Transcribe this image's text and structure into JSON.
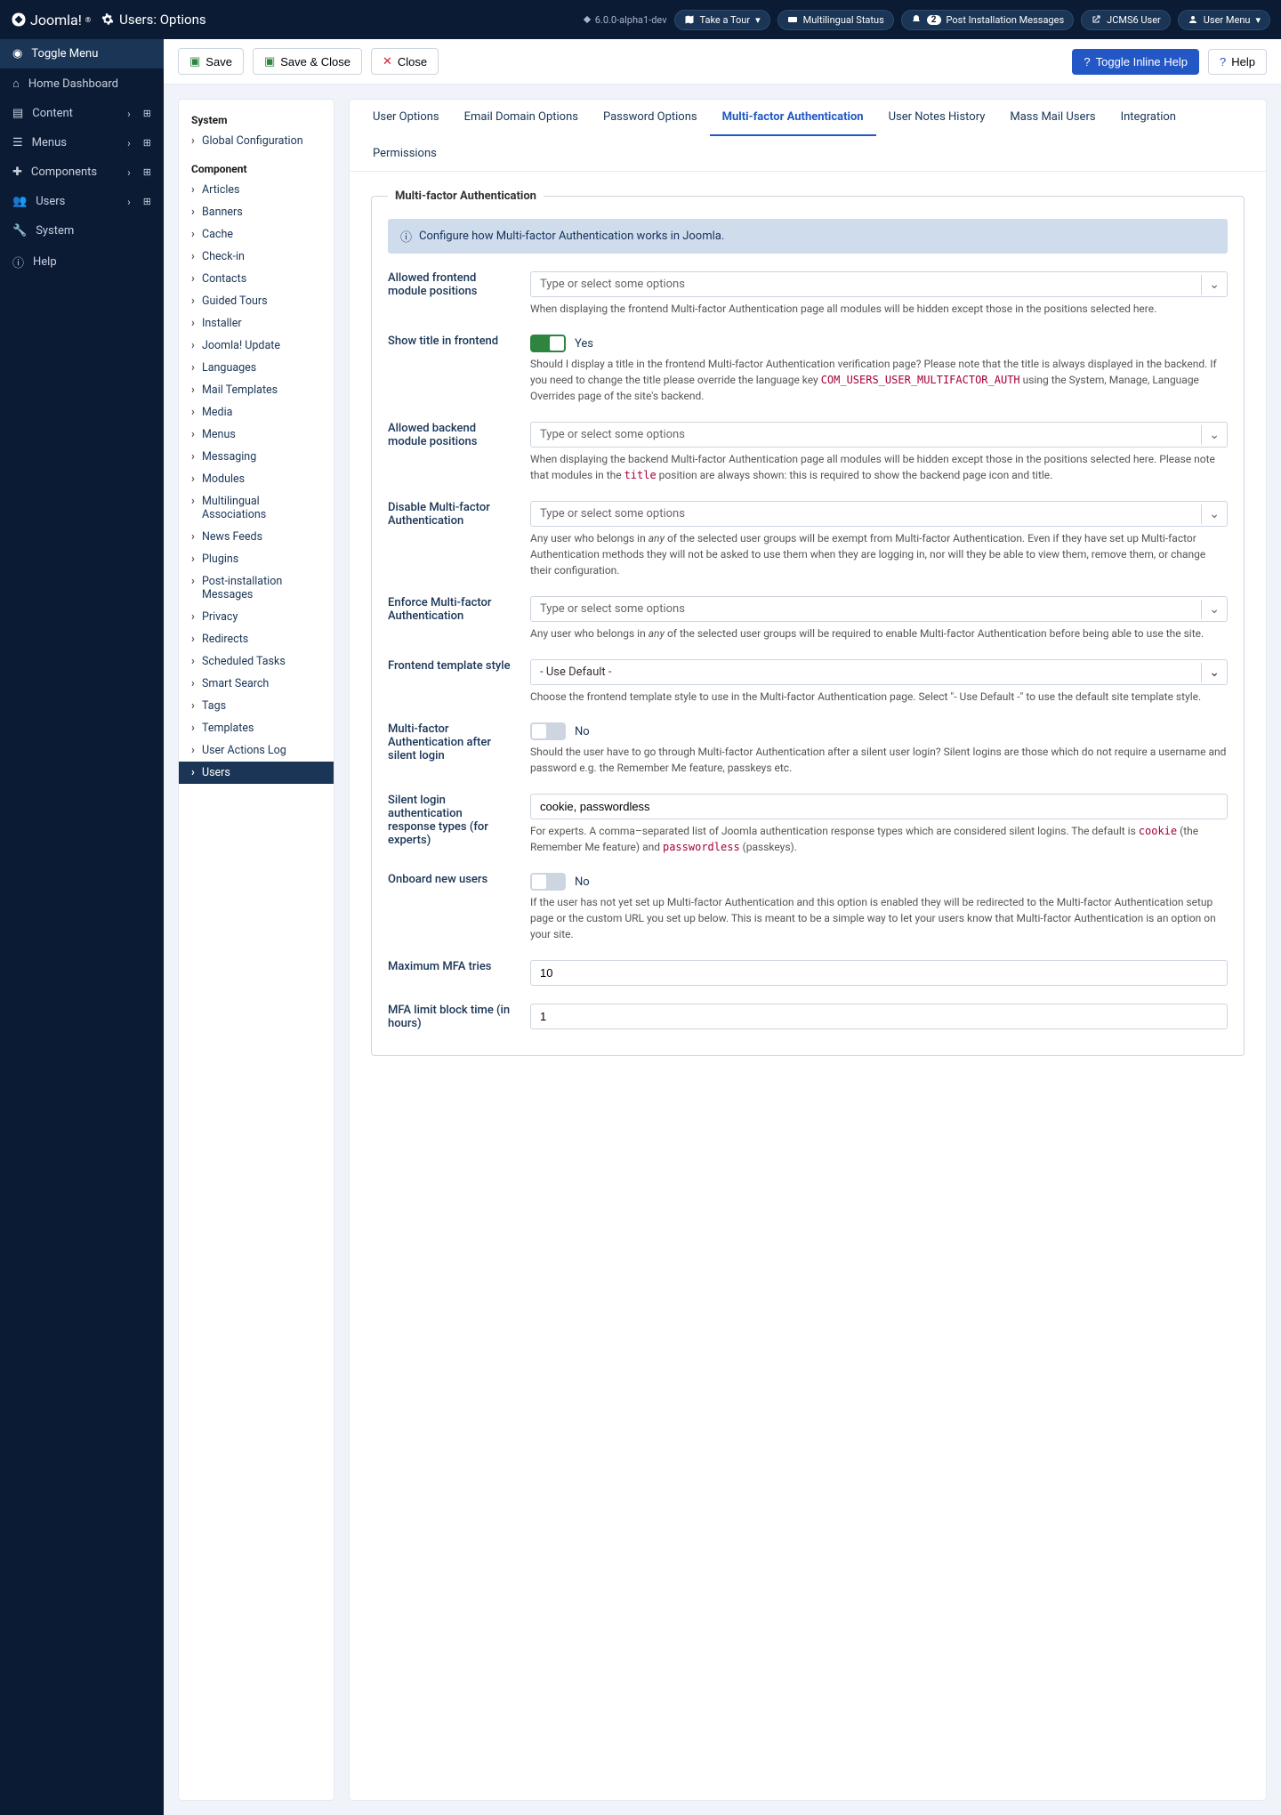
{
  "brand": "Joomla!",
  "page_title": "Users: Options",
  "version": "6.0.0-alpha1-dev",
  "header_chips": {
    "tour": "Take a Tour",
    "multilingual": "Multilingual Status",
    "post_install": "Post Installation Messages",
    "post_install_count": "2",
    "site_link": "JCMS6 User",
    "user_menu": "User Menu"
  },
  "sidebar": {
    "toggle": "Toggle Menu",
    "home": "Home Dashboard",
    "content": "Content",
    "menus": "Menus",
    "components": "Components",
    "users": "Users",
    "system": "System",
    "help": "Help"
  },
  "toolbar": {
    "save": "Save",
    "save_close": "Save & Close",
    "close": "Close",
    "toggle_help": "Toggle Inline Help",
    "help": "Help"
  },
  "leftmenu": {
    "system_h": "System",
    "global_config": "Global Configuration",
    "component_h": "Component",
    "items": [
      "Articles",
      "Banners",
      "Cache",
      "Check-in",
      "Contacts",
      "Guided Tours",
      "Installer",
      "Joomla! Update",
      "Languages",
      "Mail Templates",
      "Media",
      "Menus",
      "Messaging",
      "Modules",
      "Multilingual Associations",
      "News Feeds",
      "Plugins",
      "Post-installation Messages",
      "Privacy",
      "Redirects",
      "Scheduled Tasks",
      "Smart Search",
      "Tags",
      "Templates",
      "User Actions Log",
      "Users"
    ],
    "active_index": 25
  },
  "tabs": [
    "User Options",
    "Email Domain Options",
    "Password Options",
    "Multi-factor Authentication",
    "User Notes History",
    "Mass Mail Users",
    "Integration",
    "Permissions"
  ],
  "active_tab": 3,
  "fieldset_legend": "Multi-factor Authentication",
  "alert_text": "Configure how Multi-factor Authentication works in Joomla.",
  "fields": {
    "frontend_positions": {
      "label": "Allowed frontend module positions",
      "placeholder": "Type or select some options",
      "desc": "When displaying the frontend Multi-factor Authentication page all modules will be hidden except those in the positions selected here."
    },
    "show_title": {
      "label": "Show title in frontend",
      "value": "Yes",
      "desc_pre": "Should I display a title in the frontend Multi-factor Authentication verification page? Please note that the title is always displayed in the backend. If you need to change the title please override the language key ",
      "desc_code": "COM_USERS_USER_MULTIFACTOR_AUTH",
      "desc_post": " using the System, Manage, Language Overrides page of the site's backend."
    },
    "backend_positions": {
      "label": "Allowed backend module positions",
      "placeholder": "Type or select some options",
      "desc_pre": "When displaying the backend Multi-factor Authentication page all modules will be hidden except those in the positions selected here. Please note that modules in the ",
      "desc_code": "title",
      "desc_post": " position are always shown: this is required to show the backend page icon and title."
    },
    "disable_mfa": {
      "label": "Disable Multi-factor Authentication",
      "placeholder": "Type or select some options",
      "desc_pre": "Any user who belongs in ",
      "desc_em": "any",
      "desc_post": " of the selected user groups will be exempt from Multi-factor Authentication. Even if they have set up Multi-factor Authentication methods they will not be asked to use them when they are logging in, nor will they be able to view them, remove them, or change their configuration."
    },
    "enforce_mfa": {
      "label": "Enforce Multi-factor Authentication",
      "placeholder": "Type or select some options",
      "desc_pre": "Any user who belongs in ",
      "desc_em": "any",
      "desc_post": " of the selected user groups will be required to enable Multi-factor Authentication before being able to use the site."
    },
    "template_style": {
      "label": "Frontend template style",
      "value": "- Use Default -",
      "desc": "Choose the frontend template style to use in the Multi-factor Authentication page. Select \"- Use Default -\" to use the default site template style."
    },
    "after_silent": {
      "label": "Multi-factor Authentication after silent login",
      "value": "No",
      "desc": "Should the user have to go through Multi-factor Authentication after a silent user login? Silent logins are those which do not require a username and password e.g. the Remember Me feature, passkeys etc."
    },
    "silent_types": {
      "label": "Silent login authentication response types (for experts)",
      "value": "cookie, passwordless",
      "desc_pre": "For experts. A comma–separated list of Joomla authentication response types which are considered silent logins. The default is ",
      "desc_code1": "cookie",
      "desc_mid": " (the Remember Me feature) and ",
      "desc_code2": "passwordless",
      "desc_post": " (passkeys)."
    },
    "onboard": {
      "label": "Onboard new users",
      "value": "No",
      "desc": "If the user has not yet set up Multi-factor Authentication and this option is enabled they will be redirected to the Multi-factor Authentication setup page or the custom URL you set up below. This is meant to be a simple way to let your users know that Multi-factor Authentication is an option on your site."
    },
    "max_tries": {
      "label": "Maximum MFA tries",
      "value": "10"
    },
    "block_time": {
      "label": "MFA limit block time (in hours)",
      "value": "1"
    }
  }
}
